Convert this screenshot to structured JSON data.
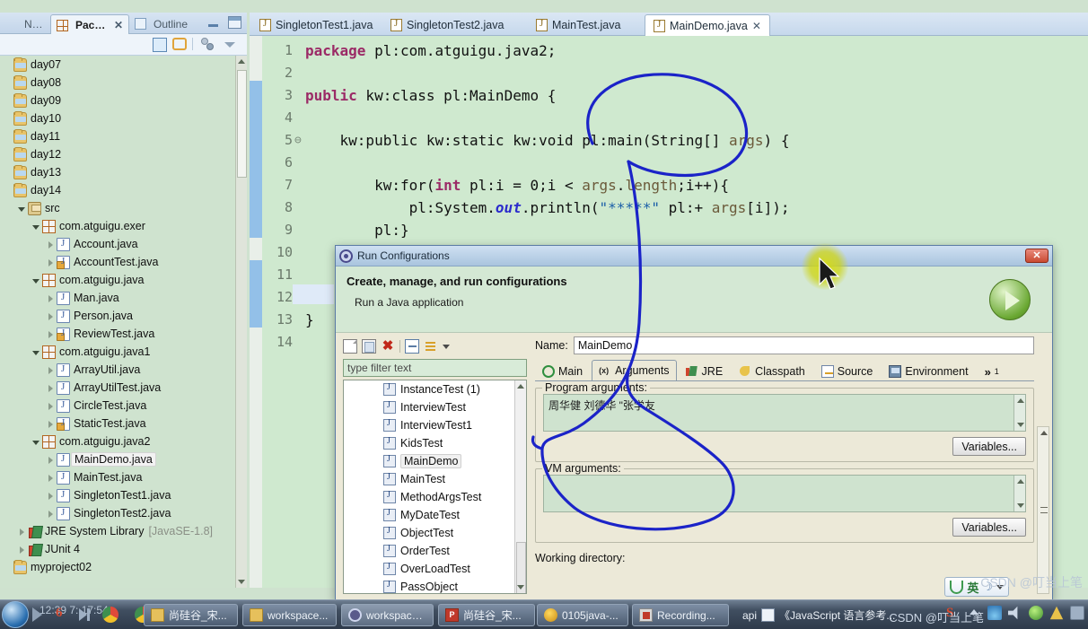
{
  "views": {
    "tabs": [
      {
        "label": "Navig...",
        "icon": "navigator-icon",
        "active": false
      },
      {
        "label": "Packa...",
        "icon": "package-explorer-icon",
        "active": true,
        "close": "✕"
      },
      {
        "label": "Outline",
        "icon": "outline-icon",
        "active": false
      }
    ],
    "toolbar": [
      {
        "name": "collapse-all-icon"
      },
      {
        "name": "link-with-editor-icon"
      },
      {
        "name": "view-menu-icon"
      },
      {
        "name": "view-chevron-icon"
      }
    ]
  },
  "tree": {
    "items": [
      {
        "label": "day07",
        "icon": "project-folder-icon",
        "indent": 0,
        "arrow": "none"
      },
      {
        "label": "day08",
        "icon": "project-folder-icon",
        "indent": 0,
        "arrow": "none"
      },
      {
        "label": "day09",
        "icon": "project-folder-icon",
        "indent": 0,
        "arrow": "none"
      },
      {
        "label": "day10",
        "icon": "project-folder-icon",
        "indent": 0,
        "arrow": "none"
      },
      {
        "label": "day11",
        "icon": "project-folder-icon",
        "indent": 0,
        "arrow": "none"
      },
      {
        "label": "day12",
        "icon": "project-folder-icon",
        "indent": 0,
        "arrow": "none"
      },
      {
        "label": "day13",
        "icon": "project-folder-icon",
        "indent": 0,
        "arrow": "none"
      },
      {
        "label": "day14",
        "icon": "project-folder-icon",
        "indent": 0,
        "arrow": "none"
      },
      {
        "label": "src",
        "icon": "source-folder-icon",
        "indent": 1,
        "arrow": "open"
      },
      {
        "label": "com.atguigu.exer",
        "icon": "package-icon",
        "indent": 2,
        "arrow": "open"
      },
      {
        "label": "Account.java",
        "icon": "java-file-icon",
        "indent": 3,
        "arrow": "closed"
      },
      {
        "label": "AccountTest.java",
        "icon": "java-file-main-icon",
        "indent": 3,
        "arrow": "closed"
      },
      {
        "label": "com.atguigu.java",
        "icon": "package-icon",
        "indent": 2,
        "arrow": "open"
      },
      {
        "label": "Man.java",
        "icon": "java-file-icon",
        "indent": 3,
        "arrow": "closed"
      },
      {
        "label": "Person.java",
        "icon": "java-file-icon",
        "indent": 3,
        "arrow": "closed"
      },
      {
        "label": "ReviewTest.java",
        "icon": "java-file-main-icon",
        "indent": 3,
        "arrow": "closed"
      },
      {
        "label": "com.atguigu.java1",
        "icon": "package-icon",
        "indent": 2,
        "arrow": "open"
      },
      {
        "label": "ArrayUtil.java",
        "icon": "java-file-icon",
        "indent": 3,
        "arrow": "closed"
      },
      {
        "label": "ArrayUtilTest.java",
        "icon": "java-file-icon",
        "indent": 3,
        "arrow": "closed"
      },
      {
        "label": "CircleTest.java",
        "icon": "java-file-icon",
        "indent": 3,
        "arrow": "closed"
      },
      {
        "label": "StaticTest.java",
        "icon": "java-file-main-icon",
        "indent": 3,
        "arrow": "closed"
      },
      {
        "label": "com.atguigu.java2",
        "icon": "package-icon",
        "indent": 2,
        "arrow": "open"
      },
      {
        "label": "MainDemo.java",
        "icon": "java-file-icon",
        "indent": 3,
        "arrow": "closed",
        "selected": true
      },
      {
        "label": "MainTest.java",
        "icon": "java-file-icon",
        "indent": 3,
        "arrow": "closed"
      },
      {
        "label": "SingletonTest1.java",
        "icon": "java-file-icon",
        "indent": 3,
        "arrow": "closed"
      },
      {
        "label": "SingletonTest2.java",
        "icon": "java-file-icon",
        "indent": 3,
        "arrow": "closed"
      },
      {
        "label": "JRE System Library",
        "suffix": "[JavaSE-1.8]",
        "icon": "library-icon",
        "indent": 1,
        "arrow": "closed"
      },
      {
        "label": "JUnit 4",
        "icon": "library-icon",
        "indent": 1,
        "arrow": "closed"
      },
      {
        "label": "myproject02",
        "icon": "project-folder-icon",
        "indent": 0,
        "arrow": "none"
      }
    ]
  },
  "editor": {
    "tabs": [
      {
        "label": "SingletonTest1.java",
        "active": false
      },
      {
        "label": "SingletonTest2.java",
        "active": false
      },
      {
        "label": "MainTest.java",
        "active": false
      },
      {
        "label": "MainDemo.java",
        "active": true,
        "close": "✕"
      }
    ],
    "lines": [
      {
        "num": "1",
        "fold": "",
        "html": "kw:package| pl:com.atguigu.java2;"
      },
      {
        "num": "2",
        "fold": "",
        "html": ""
      },
      {
        "num": "3",
        "fold": "",
        "html": "kw:public| kw:class| pl:MainDemo {"
      },
      {
        "num": "4",
        "fold": "",
        "html": ""
      },
      {
        "num": "5",
        "fold": "⊖",
        "html": "    kw:public| kw:static| kw:void| pl:main(String[] |lv:args|pl:) {"
      },
      {
        "num": "6",
        "fold": "",
        "html": ""
      },
      {
        "num": "7",
        "fold": "",
        "html": "        kw:for|pl:(|kw:int| pl:i = 0;i < |lv:args|pl:.|lv:length|pl:;i++){"
      },
      {
        "num": "8",
        "fold": "",
        "html": "            pl:System.|fld:out|pl:.println(|str:\"*****\"| pl:+ |lv:args|pl:[i]);"
      },
      {
        "num": "9",
        "fold": "",
        "html": "        pl:}"
      },
      {
        "num": "10",
        "fold": "",
        "html": ""
      },
      {
        "num": "11",
        "fold": "",
        "html": ""
      },
      {
        "num": "12",
        "fold": "",
        "html": ""
      },
      {
        "num": "13",
        "fold": "",
        "html": "pl:}"
      },
      {
        "num": "14",
        "fold": "",
        "html": ""
      }
    ]
  },
  "dialog": {
    "title": "Run Configurations",
    "heading": "Create, manage, and run configurations",
    "subheading": "Run a Java application",
    "close_label": "✕",
    "run_button": "run-icon",
    "left_toolbar": [
      {
        "name": "new-configuration-icon"
      },
      {
        "name": "duplicate-icon"
      },
      {
        "name": "delete-icon"
      },
      {
        "name": "collapse-all-icon"
      },
      {
        "name": "filter-icon"
      },
      {
        "name": "dropdown-caret-icon"
      }
    ],
    "filter_placeholder": "type filter text",
    "configurations": [
      {
        "label": "InstanceTest (1)"
      },
      {
        "label": "InterviewTest"
      },
      {
        "label": "InterviewTest1"
      },
      {
        "label": "KidsTest"
      },
      {
        "label": "MainDemo",
        "selected": true
      },
      {
        "label": "MainTest"
      },
      {
        "label": "MethodArgsTest"
      },
      {
        "label": "MyDateTest"
      },
      {
        "label": "ObjectTest"
      },
      {
        "label": "OrderTest"
      },
      {
        "label": "OverLoadTest"
      },
      {
        "label": "PassObject"
      }
    ],
    "name_label": "Name:",
    "name_value": "MainDemo",
    "tabs": [
      {
        "label": "Main",
        "icon": "main-tab-icon",
        "active": false
      },
      {
        "label": "Arguments",
        "icon": "arguments-tab-icon",
        "active": true
      },
      {
        "label": "JRE",
        "icon": "jre-tab-icon",
        "active": false
      },
      {
        "label": "Classpath",
        "icon": "classpath-tab-icon",
        "active": false
      },
      {
        "label": "Source",
        "icon": "source-tab-icon",
        "active": false
      },
      {
        "label": "Environment",
        "icon": "environment-tab-icon",
        "active": false
      }
    ],
    "overflow_tab": "»",
    "overflow_count": "1",
    "program_arguments_label": "Program arguments:",
    "program_arguments_value": "周华健 刘德华 \"张学友",
    "vm_arguments_label": "VM arguments:",
    "vm_arguments_value": "",
    "variables_button_1": "Variables...",
    "variables_button_2": "Variables...",
    "working_directory_label": "Working directory:"
  },
  "taskbar": {
    "clock": "12:39 7: 17:54",
    "quick_icons": [
      {
        "name": "media-play-icon"
      },
      {
        "name": "360-browser-icon"
      },
      {
        "name": "next-track-icon"
      },
      {
        "name": "chrome-icon"
      },
      {
        "name": "chrome-icon-2"
      }
    ],
    "buttons": [
      {
        "label": "尚硅谷_宋...",
        "icon": "folder-icon"
      },
      {
        "label": "workspace...",
        "icon": "folder-icon"
      },
      {
        "label": "workspace...",
        "icon": "eclipse-icon",
        "active": true
      },
      {
        "label": "尚硅谷_宋...",
        "icon": "powerpoint-icon"
      },
      {
        "label": "0105java-...",
        "icon": "media-icon"
      },
      {
        "label": "Recording...",
        "icon": "recorder-icon"
      },
      {
        "label": "《JavaScript 语言参考...",
        "icon": "help-icon",
        "prefix": "api"
      }
    ],
    "ime": {
      "lang": "英",
      "icon": "sogou-ime-icon",
      "moon": "☽"
    },
    "tray": [
      {
        "name": "sogou-icon"
      },
      {
        "name": "show-hidden-icon"
      },
      {
        "name": "network-icon"
      },
      {
        "name": "volume-icon"
      },
      {
        "name": "security-icon"
      },
      {
        "name": "warning-icon"
      },
      {
        "name": "battery-icon"
      }
    ],
    "watermark": "CSDN @叮当上笔"
  }
}
